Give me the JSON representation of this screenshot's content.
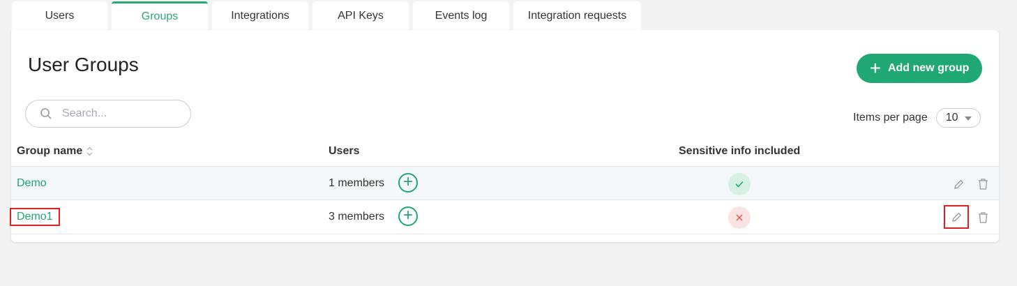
{
  "tabs": [
    {
      "label": "Users",
      "active": false
    },
    {
      "label": "Groups",
      "active": true
    },
    {
      "label": "Integrations",
      "active": false
    },
    {
      "label": "API Keys",
      "active": false
    },
    {
      "label": "Events log",
      "active": false
    },
    {
      "label": "Integration requests",
      "active": false
    }
  ],
  "page": {
    "title": "User Groups",
    "add_button_label": "Add new group",
    "search_placeholder": "Search...",
    "items_per_page_label": "Items per page",
    "items_per_page_value": "10"
  },
  "table": {
    "headers": {
      "group_name": "Group name",
      "users": "Users",
      "sensitive": "Sensitive info included"
    },
    "rows": [
      {
        "name": "Demo",
        "users": "1 members",
        "sensitive": true
      },
      {
        "name": "Demo1",
        "users": "3 members",
        "sensitive": false
      }
    ]
  },
  "colors": {
    "accent": "#1fa774",
    "danger": "#e05555",
    "highlight": "#e02020"
  },
  "icons": [
    "search-icon",
    "plus-icon",
    "sort-icon",
    "add-member-icon",
    "check-icon",
    "x-icon",
    "pencil-icon",
    "trash-icon"
  ]
}
